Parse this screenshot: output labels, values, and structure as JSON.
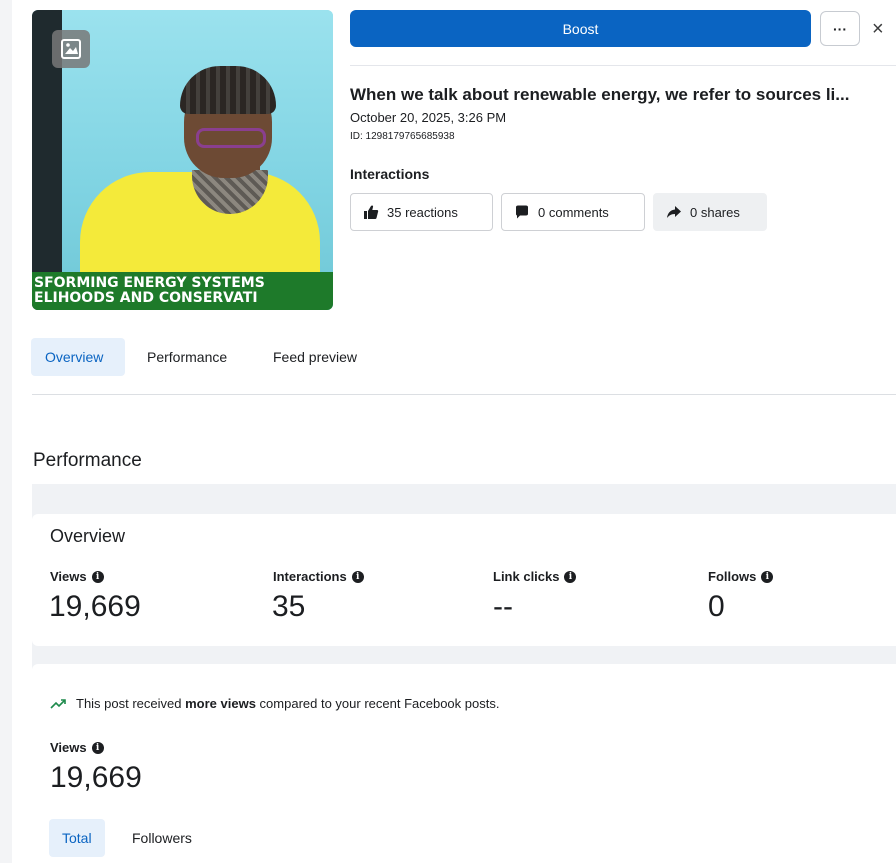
{
  "post": {
    "boost_label": "Boost",
    "more_label": "···",
    "close_label": "×",
    "title": "When we talk about renewable energy, we refer to sources li...",
    "date": "October 20, 2025, 3:26 PM",
    "id_text": "ID: 1298179765685938",
    "thumbnail": {
      "banner_line1": "SFORMING ENERGY SYSTEMS",
      "banner_line2": "ELIHOODS AND CONSERVATI"
    }
  },
  "interactions": {
    "title": "Interactions",
    "reactions": "35 reactions",
    "comments": "0 comments",
    "shares": "0 shares"
  },
  "tabs": [
    {
      "label": "Overview"
    },
    {
      "label": "Performance"
    },
    {
      "label": "Feed preview"
    }
  ],
  "performance": {
    "section_title": "Performance",
    "overview_title": "Overview",
    "metrics": [
      {
        "label": "Views",
        "value": "19,669"
      },
      {
        "label": "Interactions",
        "value": "35"
      },
      {
        "label": "Link clicks",
        "value": "--"
      },
      {
        "label": "Follows",
        "value": "0"
      }
    ],
    "trend_prefix": "This post received ",
    "trend_bold": "more views",
    "trend_suffix": " compared to your recent Facebook posts.",
    "views_label": "Views",
    "views_value": "19,669",
    "subtabs": [
      {
        "label": "Total"
      },
      {
        "label": "Followers"
      }
    ]
  },
  "colors": {
    "accent": "#0a64c2",
    "active_tab_bg": "#e6f0fb",
    "banner_green": "#1e7a2a",
    "shirt_yellow": "#f4ea3a"
  },
  "icons": [
    "gallery-icon",
    "like-icon",
    "comment-icon",
    "share-icon",
    "info-icon",
    "trend-up-icon",
    "close-icon",
    "more-icon"
  ]
}
